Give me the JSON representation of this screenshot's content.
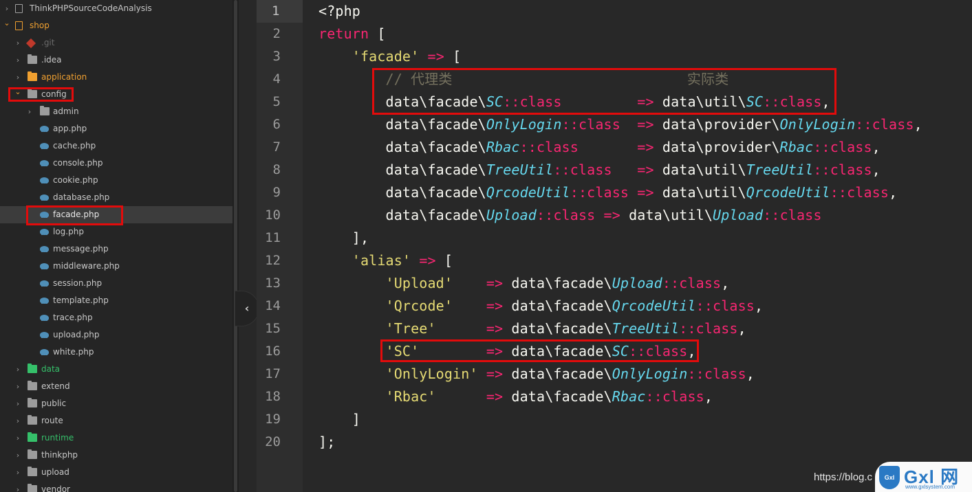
{
  "sidebar": {
    "items": [
      {
        "label": "ThinkPHPSourceCodeAnalysis",
        "icon": "project-icon",
        "expanded": false
      },
      {
        "label": "shop",
        "icon": "project-icon",
        "expanded": true
      },
      {
        "label": ".git",
        "icon": "git-icon",
        "expanded": false
      },
      {
        "label": ".idea",
        "icon": "folder-icon",
        "expanded": false
      },
      {
        "label": "application",
        "icon": "folder-icon",
        "expanded": false
      },
      {
        "label": "config",
        "icon": "folder-icon",
        "expanded": true
      },
      {
        "label": "admin",
        "icon": "folder-icon",
        "expanded": false
      },
      {
        "label": "app.php",
        "icon": "php-file-icon"
      },
      {
        "label": "cache.php",
        "icon": "php-file-icon"
      },
      {
        "label": "console.php",
        "icon": "php-file-icon"
      },
      {
        "label": "cookie.php",
        "icon": "php-file-icon"
      },
      {
        "label": "database.php",
        "icon": "php-file-icon"
      },
      {
        "label": "facade.php",
        "icon": "php-file-icon",
        "selected": true
      },
      {
        "label": "log.php",
        "icon": "php-file-icon"
      },
      {
        "label": "message.php",
        "icon": "php-file-icon"
      },
      {
        "label": "middleware.php",
        "icon": "php-file-icon"
      },
      {
        "label": "session.php",
        "icon": "php-file-icon"
      },
      {
        "label": "template.php",
        "icon": "php-file-icon"
      },
      {
        "label": "trace.php",
        "icon": "php-file-icon"
      },
      {
        "label": "upload.php",
        "icon": "php-file-icon"
      },
      {
        "label": "white.php",
        "icon": "php-file-icon"
      },
      {
        "label": "data",
        "icon": "folder-icon",
        "expanded": false
      },
      {
        "label": "extend",
        "icon": "folder-icon",
        "expanded": false
      },
      {
        "label": "public",
        "icon": "folder-icon",
        "expanded": false
      },
      {
        "label": "route",
        "icon": "folder-icon",
        "expanded": false
      },
      {
        "label": "runtime",
        "icon": "folder-icon",
        "expanded": false
      },
      {
        "label": "thinkphp",
        "icon": "folder-icon",
        "expanded": false
      },
      {
        "label": "upload",
        "icon": "folder-icon",
        "expanded": false
      },
      {
        "label": "vendor",
        "icon": "folder-icon",
        "expanded": false
      }
    ]
  },
  "collapse_icon": "chevron-left-icon",
  "colors": {
    "keyword": "#f92672",
    "string": "#e6db74",
    "class_name": "#66d9ef",
    "comment": "#75715e",
    "highlight_box": "#e30b0b",
    "folder_orange": "#f0a030",
    "folder_green": "#35c06a"
  },
  "editor": {
    "active_line": 1,
    "lines": [
      {
        "n": "1",
        "tokens": [
          [
            "pl",
            "<?php"
          ]
        ]
      },
      {
        "n": "2",
        "tokens": [
          [
            "kw",
            "return"
          ],
          [
            "pl",
            " ["
          ]
        ]
      },
      {
        "n": "3",
        "tokens": [
          [
            "pl",
            "    "
          ],
          [
            "str",
            "'facade'"
          ],
          [
            "pl",
            " "
          ],
          [
            "op",
            "=>"
          ],
          [
            "pl",
            " ["
          ]
        ]
      },
      {
        "n": "4",
        "tokens": [
          [
            "pl",
            "        "
          ],
          [
            "cm",
            "// 代理类                            实际类"
          ]
        ]
      },
      {
        "n": "5",
        "tokens": [
          [
            "pl",
            "        data\\facade\\"
          ],
          [
            "cls",
            "SC"
          ],
          [
            "op",
            "::class"
          ],
          [
            "pl",
            "         "
          ],
          [
            "op",
            "=>"
          ],
          [
            "pl",
            " data\\util\\"
          ],
          [
            "cls",
            "SC"
          ],
          [
            "op",
            "::class"
          ],
          [
            "pl",
            ","
          ]
        ]
      },
      {
        "n": "6",
        "tokens": [
          [
            "pl",
            "        data\\facade\\"
          ],
          [
            "cls",
            "OnlyLogin"
          ],
          [
            "op",
            "::class"
          ],
          [
            "pl",
            "  "
          ],
          [
            "op",
            "=>"
          ],
          [
            "pl",
            " data\\provider\\"
          ],
          [
            "cls",
            "OnlyLogin"
          ],
          [
            "op",
            "::class"
          ],
          [
            "pl",
            ","
          ]
        ]
      },
      {
        "n": "7",
        "tokens": [
          [
            "pl",
            "        data\\facade\\"
          ],
          [
            "cls",
            "Rbac"
          ],
          [
            "op",
            "::class"
          ],
          [
            "pl",
            "       "
          ],
          [
            "op",
            "=>"
          ],
          [
            "pl",
            " data\\provider\\"
          ],
          [
            "cls",
            "Rbac"
          ],
          [
            "op",
            "::class"
          ],
          [
            "pl",
            ","
          ]
        ]
      },
      {
        "n": "8",
        "tokens": [
          [
            "pl",
            "        data\\facade\\"
          ],
          [
            "cls",
            "TreeUtil"
          ],
          [
            "op",
            "::class"
          ],
          [
            "pl",
            "   "
          ],
          [
            "op",
            "=>"
          ],
          [
            "pl",
            " data\\util\\"
          ],
          [
            "cls",
            "TreeUtil"
          ],
          [
            "op",
            "::class"
          ],
          [
            "pl",
            ","
          ]
        ]
      },
      {
        "n": "9",
        "tokens": [
          [
            "pl",
            "        data\\facade\\"
          ],
          [
            "cls",
            "QrcodeUtil"
          ],
          [
            "op",
            "::class"
          ],
          [
            "pl",
            " "
          ],
          [
            "op",
            "=>"
          ],
          [
            "pl",
            " data\\util\\"
          ],
          [
            "cls",
            "QrcodeUtil"
          ],
          [
            "op",
            "::class"
          ],
          [
            "pl",
            ","
          ]
        ]
      },
      {
        "n": "10",
        "tokens": [
          [
            "pl",
            "        data\\facade\\"
          ],
          [
            "cls",
            "Upload"
          ],
          [
            "op",
            "::class"
          ],
          [
            "pl",
            " "
          ],
          [
            "op",
            "=>"
          ],
          [
            "pl",
            " data\\util\\"
          ],
          [
            "cls",
            "Upload"
          ],
          [
            "op",
            "::class"
          ]
        ]
      },
      {
        "n": "11",
        "tokens": [
          [
            "pl",
            "    ],"
          ]
        ]
      },
      {
        "n": "12",
        "tokens": [
          [
            "pl",
            "    "
          ],
          [
            "str",
            "'alias'"
          ],
          [
            "pl",
            " "
          ],
          [
            "op",
            "=>"
          ],
          [
            "pl",
            " ["
          ]
        ]
      },
      {
        "n": "13",
        "tokens": [
          [
            "pl",
            "        "
          ],
          [
            "str",
            "'Upload'"
          ],
          [
            "pl",
            "    "
          ],
          [
            "op",
            "=>"
          ],
          [
            "pl",
            " data\\facade\\"
          ],
          [
            "cls",
            "Upload"
          ],
          [
            "op",
            "::class"
          ],
          [
            "pl",
            ","
          ]
        ]
      },
      {
        "n": "14",
        "tokens": [
          [
            "pl",
            "        "
          ],
          [
            "str",
            "'Qrcode'"
          ],
          [
            "pl",
            "    "
          ],
          [
            "op",
            "=>"
          ],
          [
            "pl",
            " data\\facade\\"
          ],
          [
            "cls",
            "QrcodeUtil"
          ],
          [
            "op",
            "::class"
          ],
          [
            "pl",
            ","
          ]
        ]
      },
      {
        "n": "15",
        "tokens": [
          [
            "pl",
            "        "
          ],
          [
            "str",
            "'Tree'"
          ],
          [
            "pl",
            "      "
          ],
          [
            "op",
            "=>"
          ],
          [
            "pl",
            " data\\facade\\"
          ],
          [
            "cls",
            "TreeUtil"
          ],
          [
            "op",
            "::class"
          ],
          [
            "pl",
            ","
          ]
        ]
      },
      {
        "n": "16",
        "tokens": [
          [
            "pl",
            "        "
          ],
          [
            "str",
            "'SC'"
          ],
          [
            "pl",
            "        "
          ],
          [
            "op",
            "=>"
          ],
          [
            "pl",
            " data\\facade\\"
          ],
          [
            "cls",
            "SC"
          ],
          [
            "op",
            "::class"
          ],
          [
            "pl",
            ","
          ]
        ]
      },
      {
        "n": "17",
        "tokens": [
          [
            "pl",
            "        "
          ],
          [
            "str",
            "'OnlyLogin'"
          ],
          [
            "pl",
            " "
          ],
          [
            "op",
            "=>"
          ],
          [
            "pl",
            " data\\facade\\"
          ],
          [
            "cls",
            "OnlyLogin"
          ],
          [
            "op",
            "::class"
          ],
          [
            "pl",
            ","
          ]
        ]
      },
      {
        "n": "18",
        "tokens": [
          [
            "pl",
            "        "
          ],
          [
            "str",
            "'Rbac'"
          ],
          [
            "pl",
            "      "
          ],
          [
            "op",
            "=>"
          ],
          [
            "pl",
            " data\\facade\\"
          ],
          [
            "cls",
            "Rbac"
          ],
          [
            "op",
            "::class"
          ],
          [
            "pl",
            ","
          ]
        ]
      },
      {
        "n": "19",
        "tokens": [
          [
            "pl",
            "    ]"
          ]
        ]
      },
      {
        "n": "20",
        "tokens": [
          [
            "pl",
            "];"
          ]
        ]
      }
    ]
  },
  "watermark": {
    "url_text": "https://blog.c",
    "logo_badge": "Gxl",
    "logo_text": "Gxl 网",
    "logo_site": "www.gxlsystem.com"
  }
}
